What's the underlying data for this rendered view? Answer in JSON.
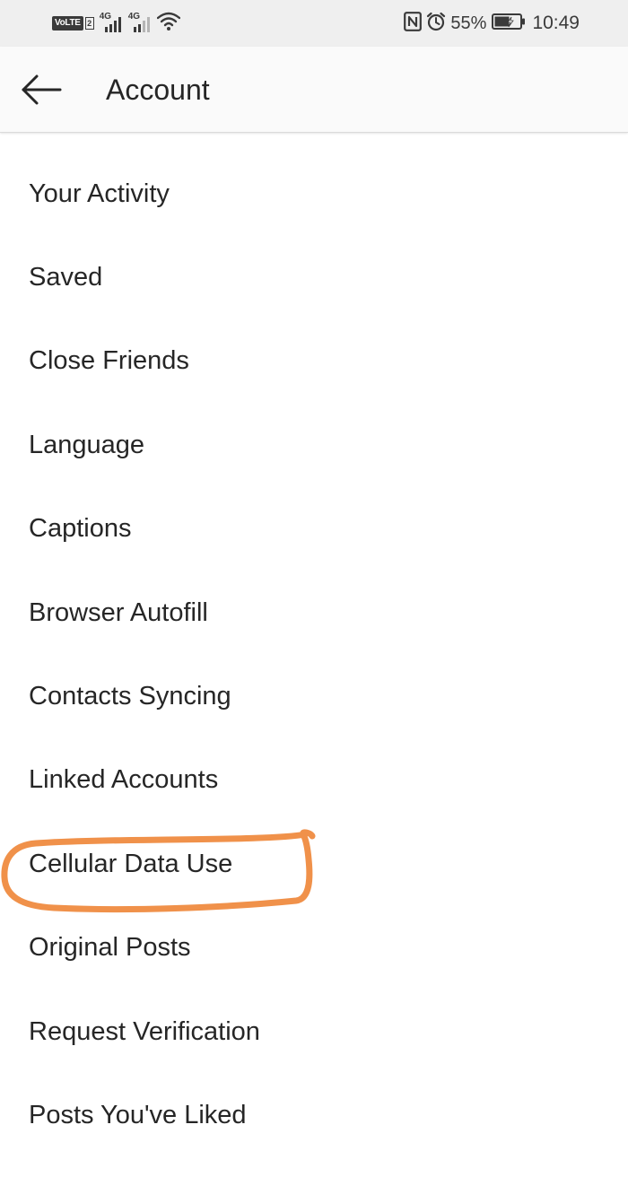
{
  "status_bar": {
    "volte_label": "VoLTE",
    "sim_number": "2",
    "network_1": "4G",
    "network_2": "4G",
    "battery_percent": "55%",
    "time": "10:49",
    "icons": [
      "volte-icon",
      "signal-icon",
      "signal-icon",
      "wifi-icon",
      "nfc-icon",
      "alarm-icon",
      "battery-icon"
    ]
  },
  "header": {
    "title": "Account",
    "back_icon": "arrow-left-icon"
  },
  "menu": {
    "items": [
      {
        "label": "Your Activity"
      },
      {
        "label": "Saved"
      },
      {
        "label": "Close Friends"
      },
      {
        "label": "Language"
      },
      {
        "label": "Captions"
      },
      {
        "label": "Browser Autofill"
      },
      {
        "label": "Contacts Syncing"
      },
      {
        "label": "Linked Accounts"
      },
      {
        "label": "Cellular Data Use",
        "highlighted": true
      },
      {
        "label": "Original Posts"
      },
      {
        "label": "Request Verification"
      },
      {
        "label": "Posts You've Liked"
      }
    ]
  },
  "colors": {
    "status_bar_bg": "#efefef",
    "header_bg": "#fafafa",
    "text": "#262626",
    "highlight_stroke": "#f0914a"
  }
}
